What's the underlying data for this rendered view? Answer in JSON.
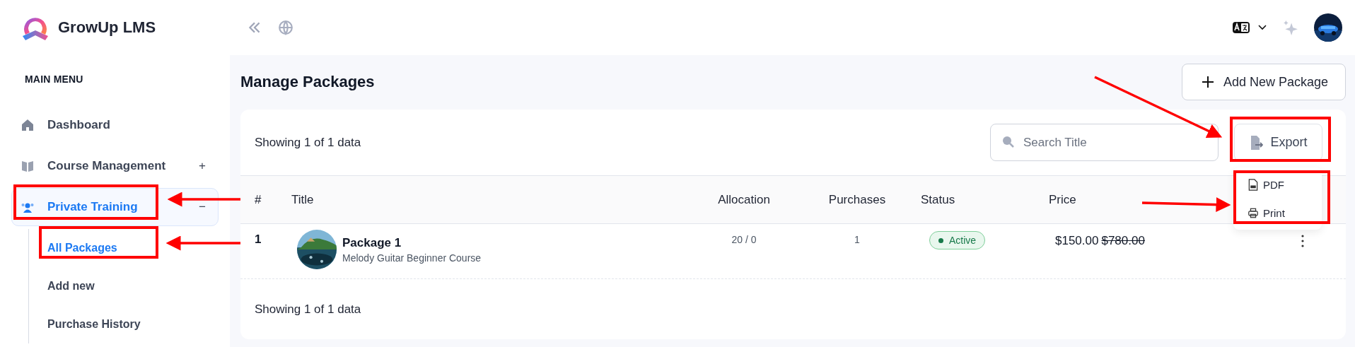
{
  "brand": {
    "name": "GrowUp LMS"
  },
  "sidebar": {
    "heading": "MAIN MENU",
    "items": [
      {
        "label": "Dashboard",
        "selected": false
      },
      {
        "label": "Course Management",
        "selected": false,
        "toggle": "+",
        "expanded": false
      },
      {
        "label": "Private Training",
        "selected": true,
        "toggle": "−",
        "expanded": true,
        "children": [
          {
            "label": "All Packages",
            "selected": true
          },
          {
            "label": "Add new",
            "selected": false
          },
          {
            "label": "Purchase History",
            "selected": false
          }
        ]
      }
    ]
  },
  "page": {
    "title": "Manage Packages",
    "add_button": "Add New Package"
  },
  "card": {
    "summary": "Showing 1 of 1 data",
    "search": {
      "placeholder": "Search Title"
    },
    "export_button": "Export",
    "export_menu": {
      "open": true,
      "items": [
        "PDF",
        "Print"
      ]
    },
    "table": {
      "columns": [
        "#",
        "Title",
        "Allocation",
        "Purchases",
        "Status",
        "Price"
      ],
      "rows": [
        {
          "index": "1",
          "title": "Package 1",
          "subtitle": "Melody Guitar Beginner Course",
          "allocation": "20 / 0",
          "purchases": "1",
          "status": {
            "label": "Active",
            "kind": "active"
          },
          "price": "$150.00",
          "original_price": "$780.00"
        }
      ]
    },
    "footer_summary": "Showing 1 of 1 data"
  }
}
